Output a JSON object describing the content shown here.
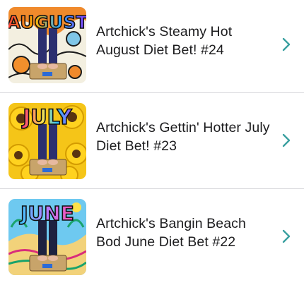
{
  "colors": {
    "text": "#1c1c1e",
    "chevron": "#3aa0a0",
    "divider": "#d8d8dc"
  },
  "list": {
    "items": [
      {
        "thumbnail_text": "AUGUST",
        "title": "Artchick's Steamy Hot August Diet Bet! #24",
        "chevron_icon": "chevron-right-icon"
      },
      {
        "thumbnail_text": "JULY",
        "title": "Artchick's Gettin' Hotter July Diet Bet! #23",
        "chevron_icon": "chevron-right-icon"
      },
      {
        "thumbnail_text": "JUNE",
        "title": "Artchick's Bangin Beach Bod June Diet Bet #22",
        "chevron_icon": "chevron-right-icon"
      }
    ]
  }
}
